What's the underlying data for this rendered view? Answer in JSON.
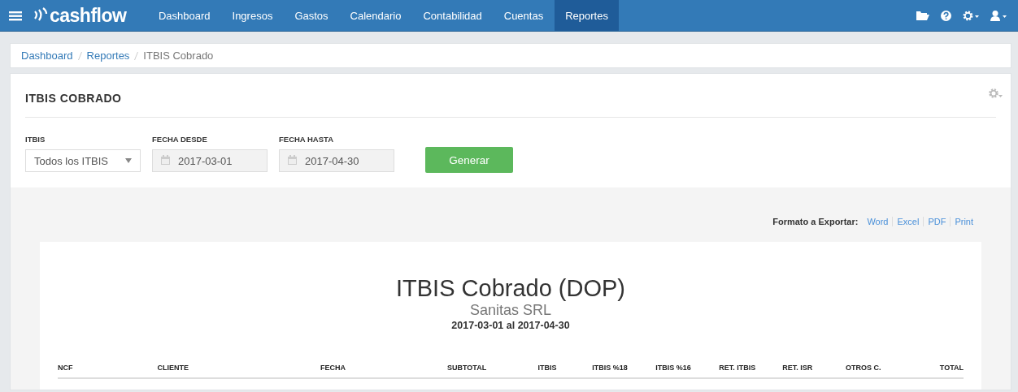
{
  "navbar": {
    "brand": "cashflow",
    "items": [
      {
        "label": "Dashboard",
        "selected": false
      },
      {
        "label": "Ingresos",
        "selected": false
      },
      {
        "label": "Gastos",
        "selected": false
      },
      {
        "label": "Calendario",
        "selected": false
      },
      {
        "label": "Contabilidad",
        "selected": false
      },
      {
        "label": "Cuentas",
        "selected": false
      },
      {
        "label": "Reportes",
        "selected": true
      }
    ]
  },
  "breadcrumb": [
    {
      "label": "Dashboard",
      "kind": "link"
    },
    {
      "label": "Reportes",
      "kind": "link"
    },
    {
      "label": "ITBIS Cobrado",
      "kind": "current"
    }
  ],
  "panel": {
    "title": "ITBIS COBRADO",
    "filters": [
      {
        "kind": "select",
        "label": "ITBIS",
        "value": "Todos los ITBIS"
      },
      {
        "kind": "date",
        "label": "FECHA DESDE",
        "value": "2017-03-01"
      },
      {
        "kind": "date",
        "label": "FECHA HASTA",
        "value": "2017-04-30"
      }
    ],
    "button": "Generar"
  },
  "export": {
    "label": "Formato a Exportar:",
    "formats": [
      "Word",
      "Excel",
      "PDF",
      "Print"
    ]
  },
  "report": {
    "title": "ITBIS Cobrado (DOP)",
    "company": "Sanitas SRL",
    "period": "2017-03-01 al 2017-04-30",
    "columns": [
      "NCF",
      "CLIENTE",
      "FECHA",
      "SUBTOTAL",
      "ITBIS",
      "ITBIS %18",
      "ITBIS %16",
      "RET. ITBIS",
      "RET. ISR",
      "OTROS C.",
      "TOTAL"
    ]
  }
}
